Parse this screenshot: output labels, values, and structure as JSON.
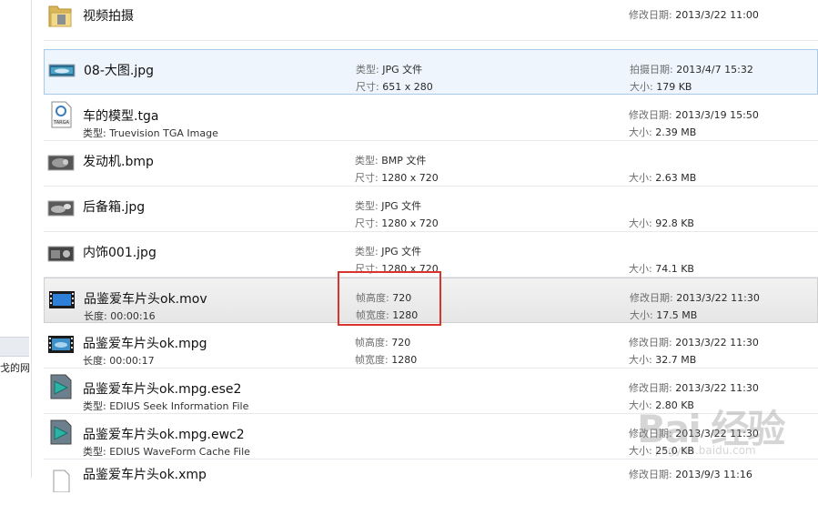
{
  "nav": {
    "partial_text": "戈的网"
  },
  "files": [
    {
      "name": "视频拍摄",
      "sub": "",
      "m1k": "",
      "m1v": "",
      "m2k": "",
      "m2v": "",
      "r1k": "修改日期:",
      "r1v": "2013/3/22 11:00",
      "r2k": "",
      "r2v": "",
      "icon": "folder-icon"
    },
    {
      "name": "08-大图.jpg",
      "sub": "",
      "m1k": "类型:",
      "m1v": "JPG 文件",
      "m2k": "尺寸:",
      "m2v": "651 x 280",
      "r1k": "拍摄日期:",
      "r1v": "2013/4/7 15:32",
      "r2k": "大小:",
      "r2v": "179 KB",
      "icon": "image-thumbnail-icon"
    },
    {
      "name": "车的模型.tga",
      "sub": "类型: Truevision TGA Image",
      "m1k": "",
      "m1v": "",
      "m2k": "",
      "m2v": "",
      "r1k": "修改日期:",
      "r1v": "2013/3/19 15:50",
      "r2k": "大小:",
      "r2v": "2.39 MB",
      "icon": "targa-file-icon"
    },
    {
      "name": "发动机.bmp",
      "sub": "",
      "m1k": "类型:",
      "m1v": "BMP 文件",
      "m2k": "尺寸:",
      "m2v": "1280 x 720",
      "r1k": "",
      "r1v": "",
      "r2k": "大小:",
      "r2v": "2.63 MB",
      "icon": "image-thumbnail-icon"
    },
    {
      "name": "后备箱.jpg",
      "sub": "",
      "m1k": "类型:",
      "m1v": "JPG 文件",
      "m2k": "尺寸:",
      "m2v": "1280 x 720",
      "r1k": "",
      "r1v": "",
      "r2k": "大小:",
      "r2v": "92.8 KB",
      "icon": "image-thumbnail-icon"
    },
    {
      "name": "内饰001.jpg",
      "sub": "",
      "m1k": "类型:",
      "m1v": "JPG 文件",
      "m2k": "尺寸:",
      "m2v": "1280 x 720",
      "r1k": "",
      "r1v": "",
      "r2k": "大小:",
      "r2v": "74.1 KB",
      "icon": "image-thumbnail-icon"
    },
    {
      "name": "品鉴爱车片头ok.mov",
      "sub": "长度: 00:00:16",
      "m1k": "帧高度:",
      "m1v": "720",
      "m2k": "帧宽度:",
      "m2v": "1280",
      "r1k": "修改日期:",
      "r1v": "2013/3/22 11:30",
      "r2k": "大小:",
      "r2v": "17.5 MB",
      "icon": "video-icon"
    },
    {
      "name": "品鉴爱车片头ok.mpg",
      "sub": "长度: 00:00:17",
      "m1k": "帧高度:",
      "m1v": "720",
      "m2k": "帧宽度:",
      "m2v": "1280",
      "r1k": "修改日期:",
      "r1v": "2013/3/22 11:30",
      "r2k": "大小:",
      "r2v": "32.7 MB",
      "icon": "video-thumbnail-icon"
    },
    {
      "name": "品鉴爱车片头ok.mpg.ese2",
      "sub": "类型: EDIUS Seek Information File",
      "m1k": "",
      "m1v": "",
      "m2k": "",
      "m2v": "",
      "r1k": "修改日期:",
      "r1v": "2013/3/22 11:30",
      "r2k": "大小:",
      "r2v": "2.80 KB",
      "icon": "edius-file-icon"
    },
    {
      "name": "品鉴爱车片头ok.mpg.ewc2",
      "sub": "类型: EDIUS WaveForm Cache File",
      "m1k": "",
      "m1v": "",
      "m2k": "",
      "m2v": "",
      "r1k": "修改日期:",
      "r1v": "2013/3/22 11:30",
      "r2k": "大小:",
      "r2v": "25.0 KB",
      "icon": "edius-file-icon"
    },
    {
      "name": "品鉴爱车片头ok.xmp",
      "sub": "",
      "m1k": "",
      "m1v": "",
      "m2k": "",
      "m2v": "",
      "r1k": "修改日期:",
      "r1v": "2013/9/3 11:16",
      "r2k": "",
      "r2v": "",
      "icon": "blank-file-icon"
    }
  ],
  "watermark": {
    "logo": "Bai 经验",
    "url": "jingyan.baidu.com"
  }
}
